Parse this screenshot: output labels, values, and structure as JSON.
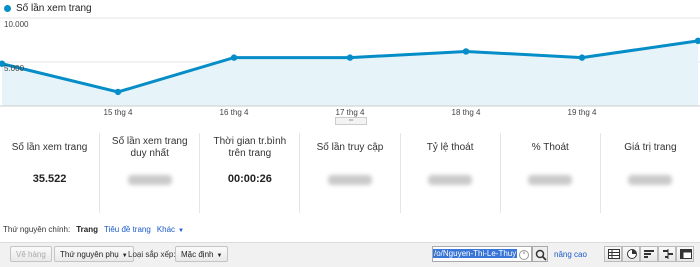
{
  "chart_data": {
    "type": "area",
    "series": [
      {
        "name": "Số lần xem trang",
        "values": [
          4800,
          1600,
          5500,
          5500,
          6200,
          5500,
          7400
        ]
      }
    ],
    "x_labels": [
      "15 thg 4",
      "16 thg 4",
      "17 thg 4",
      "18 thg 4",
      "19 thg 4"
    ],
    "y_ticks": [
      "10.000",
      "5.000"
    ],
    "ylim": [
      0,
      10000
    ],
    "grid": true
  },
  "colors": {
    "line": "#058dc7",
    "fill": "#e6f3f9"
  },
  "metrics": [
    {
      "label": "Số lần xem trang",
      "value": "35.522"
    },
    {
      "label": "Số lần xem trang duy nhất",
      "value": ""
    },
    {
      "label": "Thời gian tr.bình trên trang",
      "value": "00:00:26"
    },
    {
      "label": "Số lần truy cập",
      "value": ""
    },
    {
      "label": "Tỷ lệ thoát",
      "value": ""
    },
    {
      "label": "% Thoát",
      "value": ""
    },
    {
      "label": "Giá trị trang",
      "value": ""
    }
  ],
  "dimension": {
    "label": "Thứ nguyên chính:",
    "current": "Trang",
    "links": [
      "Tiêu đề trang",
      "Khác"
    ]
  },
  "toolbar": {
    "view_button": "Vẽ hàng",
    "secondary_dimension": "Thứ nguyên phụ",
    "sort_label": "Loại sắp xếp:",
    "sort_value": "Mặc định",
    "search_value": "/o/Nguyen-Thi-Le-Thuy",
    "advanced": "nâng cao"
  },
  "view_icons": [
    "table-icon",
    "pie-icon",
    "performance-icon",
    "comparison-icon",
    "pivot-icon"
  ]
}
